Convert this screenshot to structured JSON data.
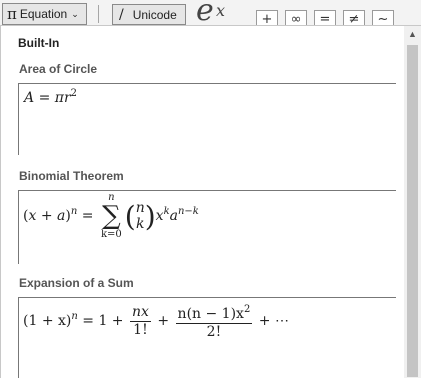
{
  "ribbon": {
    "equation_icon": "π",
    "equation_label": "Equation",
    "equation_caret": "⌄",
    "unicode_icon": "/",
    "unicode_label": "Unicode",
    "script_preview_base": "e",
    "script_preview_sup": "x",
    "symbols": [
      "+",
      "∞",
      "=",
      "≠",
      "~"
    ]
  },
  "gallery": {
    "title": "Built-In",
    "sections": [
      {
        "label": "Area of Circle",
        "lhs": "A",
        "equals": " = ",
        "pi": "π",
        "var": "r",
        "exp": "2"
      },
      {
        "label": "Binomial Theorem",
        "lhs_open": "(",
        "x": "x",
        "plus": " + ",
        "a": "a",
        "lhs_close": ")",
        "n": "n",
        "equals": " = ",
        "sum_upper": "n",
        "sum_sign": "∑",
        "sum_lower": "k=0",
        "binom_top": "n",
        "binom_bottom": "k",
        "paren_l": "(",
        "paren_r": ")",
        "term_x": "x",
        "term_x_exp": "k",
        "term_a": "a",
        "term_a_exp": "n−k"
      },
      {
        "label": "Expansion of a Sum",
        "lhs": "(1 + x)",
        "lhs_exp": "n",
        "equals": " = 1 + ",
        "frac1_num": "nx",
        "frac1_den": "1!",
        "plus": " + ",
        "frac2_num": "n(n − 1)x",
        "frac2_num_exp": "2",
        "frac2_den": "2!",
        "tail": " + ⋯"
      }
    ]
  },
  "scrollbar": {
    "up_arrow": "▲"
  }
}
